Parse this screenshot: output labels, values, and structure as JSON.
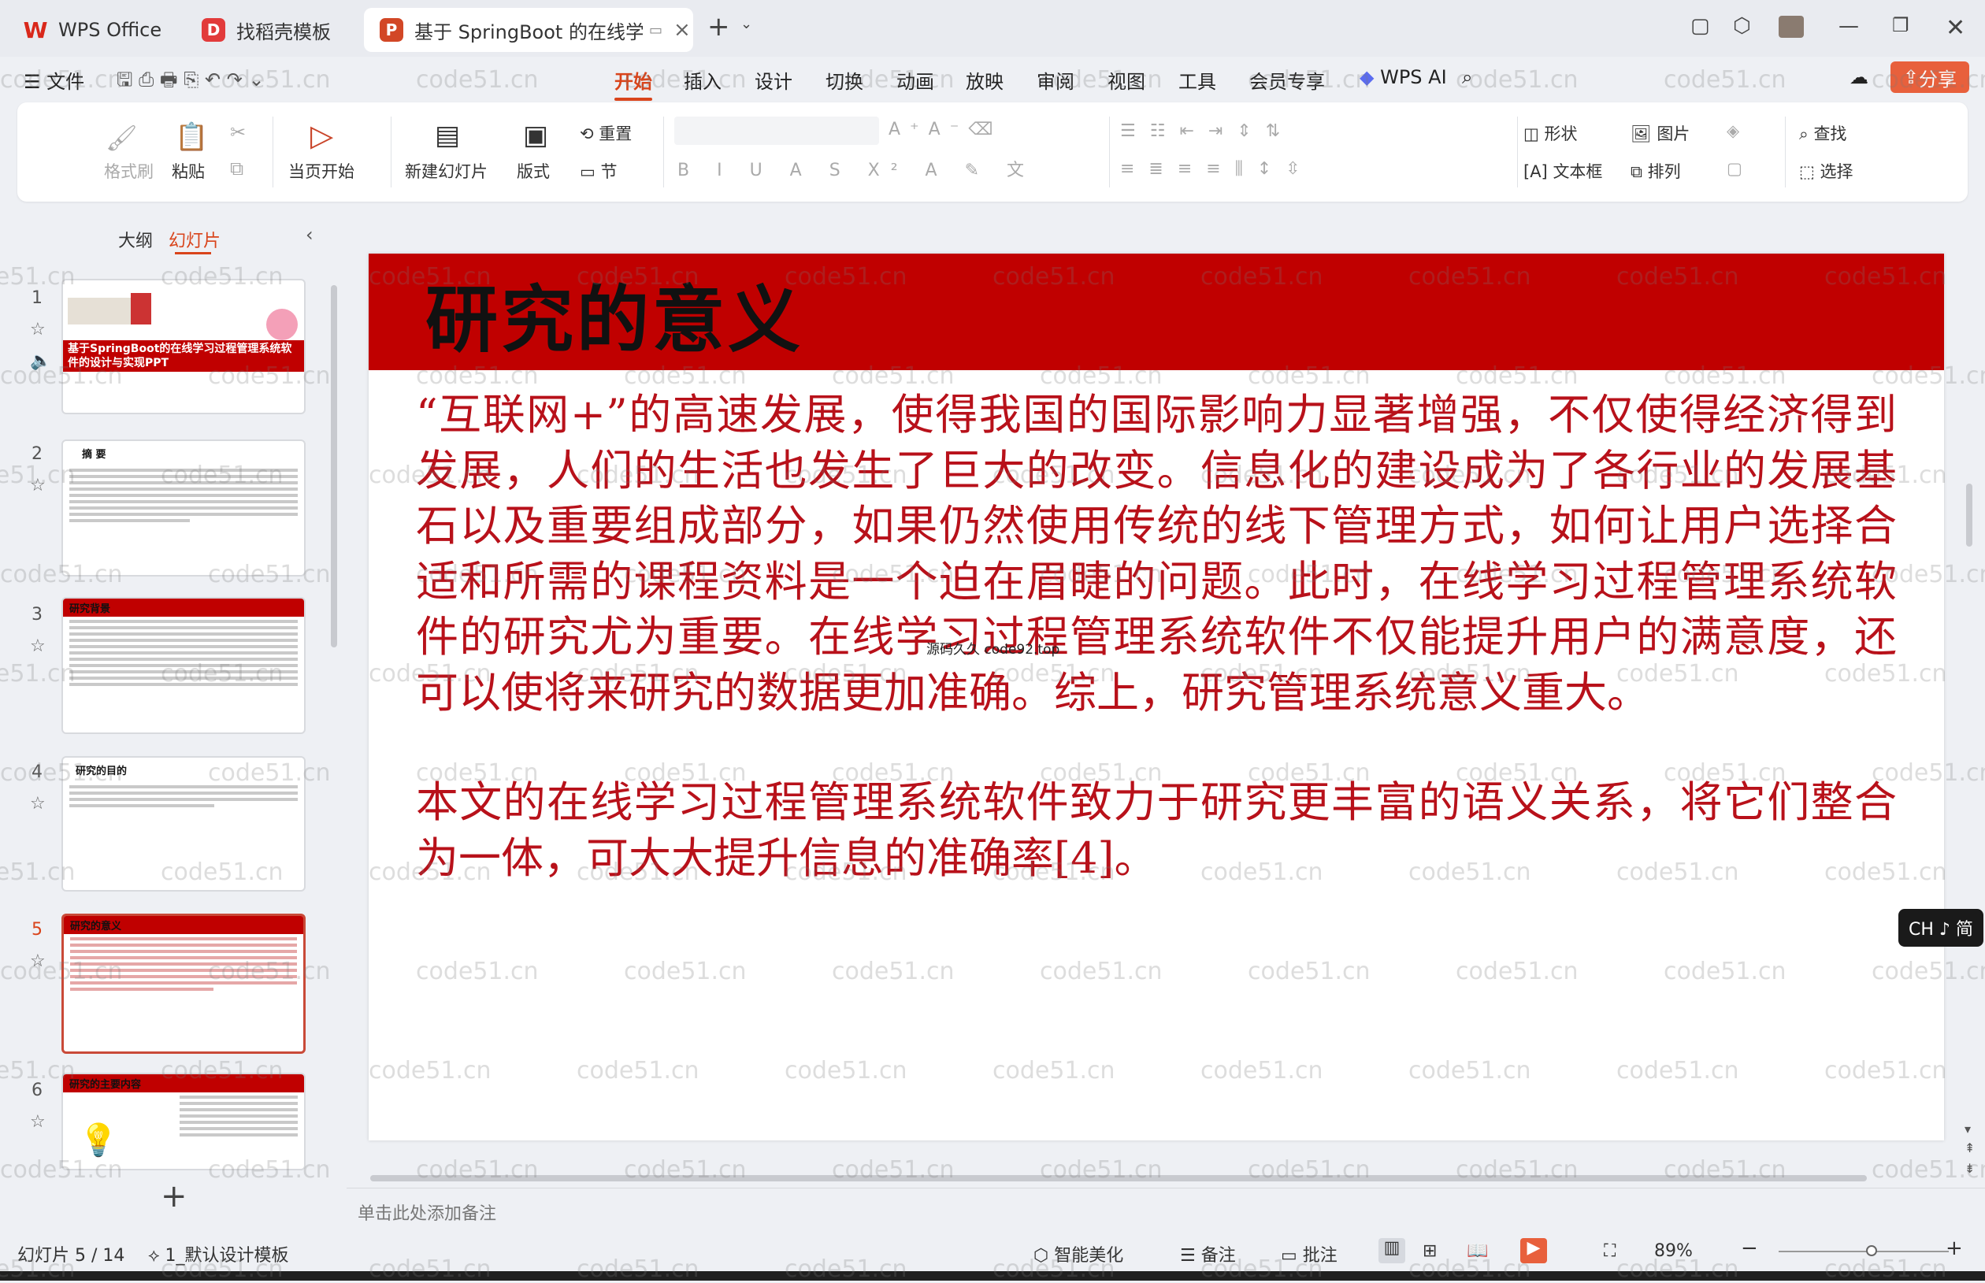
{
  "tabs": [
    {
      "label": "WPS Office",
      "logo": "W",
      "logo_color": "#d9281b"
    },
    {
      "label": "找稻壳模板",
      "logo": "D",
      "logo_color": "#e23b3b"
    },
    {
      "label": "基于 SpringBoot 的在线学习过",
      "logo": "P",
      "logo_color": "#d24726"
    }
  ],
  "menu": {
    "file": "文件",
    "items": [
      "开始",
      "插入",
      "设计",
      "切换",
      "动画",
      "放映",
      "审阅",
      "视图",
      "工具",
      "会员专享"
    ],
    "ai": "WPS AI",
    "share": "分享"
  },
  "ribbon": {
    "format_brush": "格式刷",
    "paste": "粘贴",
    "from_current": "当页开始",
    "new_slide": "新建幻灯片",
    "layout": "版式",
    "reset": "重置",
    "section": "节",
    "shape": "形状",
    "picture": "图片",
    "textbox": "文本框",
    "arrange": "排列",
    "find": "查找",
    "select": "选择"
  },
  "panel": {
    "outline_tab": "大纲",
    "slides_tab": "幻灯片",
    "thumbs": [
      {
        "num": "1",
        "title": "基于SpringBoot的在线学习过程管理系统软件的设计与实现PPT"
      },
      {
        "num": "2",
        "title": "摘 要"
      },
      {
        "num": "3",
        "title": "研究背景"
      },
      {
        "num": "4",
        "title": "研究的目的"
      },
      {
        "num": "5",
        "title": "研究的意义"
      },
      {
        "num": "6",
        "title": "研究的主要内容"
      }
    ]
  },
  "slide": {
    "title": "研究的意义",
    "paragraph1": "“互联网+”的高速发展，使得我国的国际影响力显著增强，不仅使得经济得到发展，人们的生活也发生了巨大的改变。信息化的建设成为了各行业的发展基石以及重要组成部分，如果仍然使用传统的线下管理方式，如何让用户选择合适和所需的课程资料是一个迫在眉睫的问题。此时，在线学习过程管理系统软件的研究尤为重要。在线学习过程管理系统软件不仅能提升用户的满意度，还可以使将来研究的数据更加准确。综上，研究管理系统意义重大。",
    "paragraph2": "本文的在线学习过程管理系统软件致力于研究更丰富的语义关系，将它们整合为一体，可大大提升信息的准确率[4]。",
    "center_watermark": "源码久久 code92.top",
    "title_bar_color": "#c00000",
    "text_color": "#b8111a"
  },
  "watermark": "code51.cn",
  "notes_placeholder": "单击此处添加备注",
  "status": {
    "slide_index": "幻灯片 5 / 14",
    "template": "1_默认设计模板",
    "beautify": "智能美化",
    "notes": "备注",
    "comments": "批注",
    "zoom": "89%",
    "zoom_level": 0.55
  },
  "ime": "CH ♪ 简"
}
